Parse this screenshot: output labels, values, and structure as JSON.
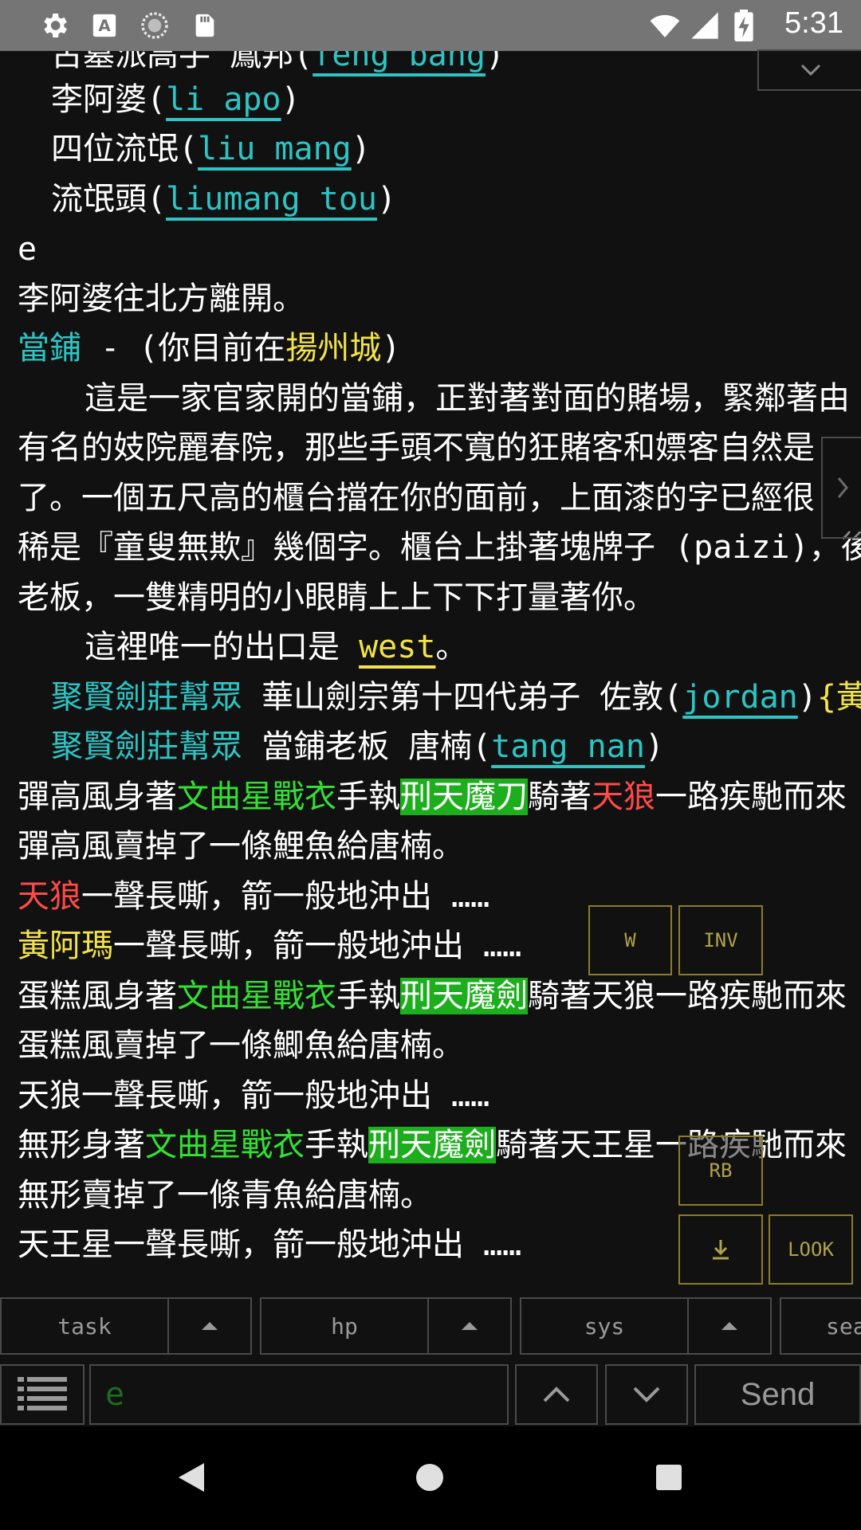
{
  "status_bar": {
    "time": "5:31",
    "icons": [
      "settings-icon",
      "font-a-icon",
      "sync-circle-icon",
      "sd-card-icon",
      "wifi-icon",
      "cell-signal-icon",
      "battery-charging-icon"
    ]
  },
  "terminal_lines": {
    "l0_text": "古墓派高手 鳳邦(",
    "l0_link": "feng bang",
    "l0_end": ")",
    "l1_text": "李阿婆(",
    "l1_link": "li apo",
    "l1_end": ")",
    "l2_text": "四位流氓(",
    "l2_link": "liu mang",
    "l2_end": ")",
    "l3_text": "流氓頭(",
    "l3_link": "liumang tou",
    "l3_end": ")",
    "l4": "e",
    "l5": "李阿婆往北方離開。",
    "l6_room": "當鋪",
    "l6_mid": " - (你目前在",
    "l6_city": "揚州城",
    "l6_end": ")",
    "l7": "這是一家官家開的當鋪，正對著對面的賭場，緊鄰著由",
    "l8": "有名的妓院麗春院，那些手頭不寬的狂賭客和嫖客自然是",
    "l9": "了。一個五尺高的櫃台擋在你的面前，上面漆的字已經很",
    "l10": "稀是『童叟無欺』幾個字。櫃台上掛著塊牌子 (paizi)，後",
    "l11": "老板，一雙精明的小眼睛上上下下打量著你。",
    "l12_text": "這裡唯一的出口是 ",
    "l12_exit": "west",
    "l12_end": "。",
    "l13_guild": "聚賢劍莊幫眾",
    "l13_text": " 華山劍宗第十四代弟子 佐敦(",
    "l13_link": "jordan",
    "l13_end": ")",
    "l13_tail": "{黃",
    "l14_guild": "聚賢劍莊幫眾",
    "l14_text": " 當鋪老板 唐楠(",
    "l14_link": "tang nan",
    "l14_end": ")",
    "l15_a": "彈高風身著",
    "l15_armor": "文曲星戰衣",
    "l15_b": "手執",
    "l15_weapon": "刑天魔刀",
    "l15_c": "騎著",
    "l15_mount": "天狼",
    "l15_d": "一路疾馳而來",
    "l16": "彈高風賣掉了一條鯉魚給唐楠。",
    "l17_mount": "天狼",
    "l17_text": "一聲長嘶，箭一般地沖出 ……",
    "l18_name": "黃阿瑪",
    "l18_text": "一聲長嘶，箭一般地沖出 ……",
    "l19_a": "蛋糕風身著",
    "l19_armor": "文曲星戰衣",
    "l19_b": "手執",
    "l19_weapon": "刑天魔劍",
    "l19_c": "騎著天狼一路疾馳而來",
    "l20": "蛋糕風賣掉了一條鯽魚給唐楠。",
    "l21": "天狼一聲長嘶，箭一般地沖出 ……",
    "l22_a": "無形身著",
    "l22_armor": "文曲星戰衣",
    "l22_b": "手執",
    "l22_weapon": "刑天魔劍",
    "l22_c": "騎著天王星一路疾馳而來",
    "l23": "無形賣掉了一條青魚給唐楠。",
    "l24": "天王星一聲長嘶，箭一般地沖出 ……"
  },
  "overlay_buttons": {
    "w": "W",
    "inv": "INV",
    "rb": "RB",
    "look": "LOOK"
  },
  "toolbar": {
    "task": "task",
    "hp": "hp",
    "sys": "sys",
    "sea": "sea"
  },
  "input": {
    "value": "e",
    "send": "Send"
  },
  "colors": {
    "cyan": "#2ec4c4",
    "yellow": "#f2e34b",
    "green": "#33e033",
    "green_bg": "#1dae1d",
    "red": "#ff4a4a",
    "overlay_border": "#8a7d2a"
  }
}
